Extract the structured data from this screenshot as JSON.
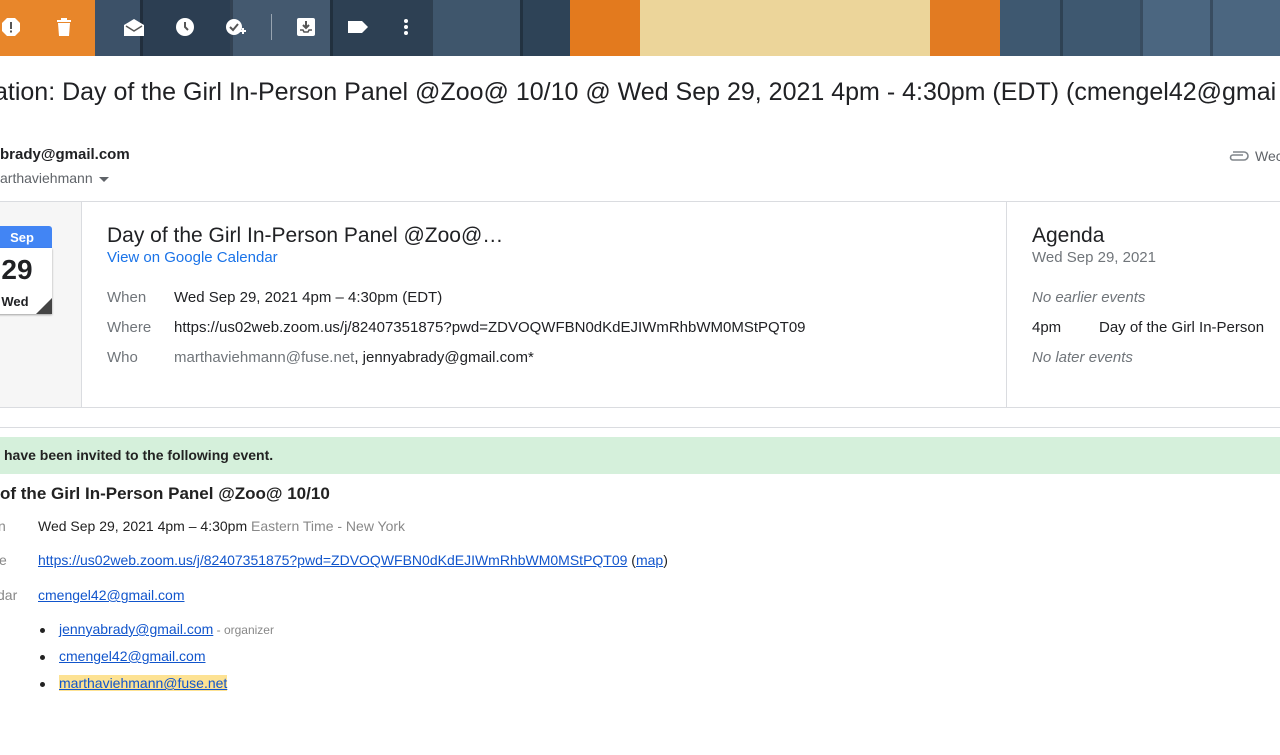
{
  "toolbar": {
    "icons": [
      "report-spam-icon",
      "delete-icon",
      "mark-unread-icon",
      "snooze-icon",
      "add-task-icon",
      "move-to-inbox-icon",
      "label-icon",
      "more-vert-icon"
    ]
  },
  "subject": "ation: Day of the Girl In-Person Panel @Zoo@ 10/10 @ Wed Sep 29, 2021 4pm - 4:30pm (EDT) (cmengel42@gmai",
  "sender": {
    "email": "brady@gmail.com",
    "to": "arthaviehmann",
    "date_partial": "Wec"
  },
  "calendar_card": {
    "date": {
      "month": "Sep",
      "day": "29",
      "weekday": "Wed"
    },
    "title": "Day of the Girl In-Person Panel @Zoo@…",
    "view_link": "View on Google Calendar",
    "when_label": "When",
    "when_value": "Wed Sep 29, 2021 4pm – 4:30pm (EDT)",
    "where_label": "Where",
    "where_value": "https://us02web.zoom.us/j/82407351875?pwd=ZDVOQWFBN0dKdEJIWmRhbWM0MStPQT09",
    "who_label": "Who",
    "who_primary": "marthaviehmann@fuse.net",
    "who_secondary": ", jennyabrady@gmail.com*"
  },
  "agenda": {
    "title": "Agenda",
    "date": "Wed Sep 29, 2021",
    "no_earlier": "No earlier events",
    "event_time": "4pm",
    "event_title": "Day of the Girl In-Person",
    "no_later": "No later events"
  },
  "invitation": {
    "banner": "have been invited to the following event.",
    "title": "of the Girl In-Person Panel @Zoo@ 10/10",
    "when_label": "n",
    "when_value": "Wed Sep 29, 2021 4pm – 4:30pm",
    "timezone": "Eastern Time - New York",
    "where_label": "e",
    "where_link": "https://us02web.zoom.us/j/82407351875?pwd=ZDVOQWFBN0dKdEJIWmRhbWM0MStPQT09",
    "map_open": " (",
    "map_link": "map",
    "map_close": ")",
    "calendar_label": "dar",
    "calendar_value": "cmengel42@gmail.com",
    "guests": [
      {
        "email": "jennyabrady@gmail.com",
        "role": " - organizer"
      },
      {
        "email": "cmengel42@gmail.com",
        "role": ""
      },
      {
        "email": "marthaviehmann@fuse.net",
        "role": ""
      }
    ]
  },
  "colors": {
    "accent_blue": "#1a73e8",
    "link_blue": "#1155cc",
    "banner_green": "#d5f0db",
    "highlight": "#fde293",
    "calendar_blue": "#4285f4"
  }
}
